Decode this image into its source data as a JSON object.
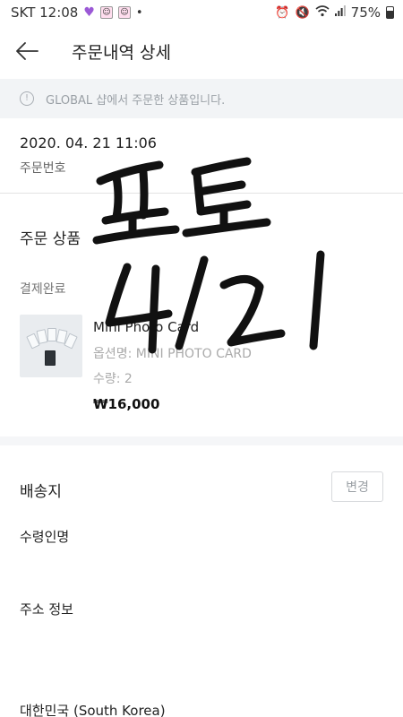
{
  "status_bar": {
    "carrier_time": "SKT 12:08",
    "battery_percent": "75%"
  },
  "header": {
    "title": "주문내역 상세"
  },
  "notice": {
    "text": "GLOBAL 샵에서 주문한 상품입니다."
  },
  "order": {
    "datetime": "2020. 04. 21 11:06",
    "number_label": "주문번호"
  },
  "ordered_products": {
    "section_title": "주문 상품",
    "payment_status": "결제완료",
    "item": {
      "name": "Mini Photo Card",
      "option": "옵션명: MINI PHOTO CARD",
      "quantity": "수량: 2",
      "price": "₩16,000"
    }
  },
  "shipping": {
    "section_title": "배송지",
    "change_label": "변경",
    "recipient_label": "수령인명",
    "address_label": "주소 정보",
    "country": "대한민국 (South Korea)"
  },
  "handwritten_note": "포토 4/21"
}
